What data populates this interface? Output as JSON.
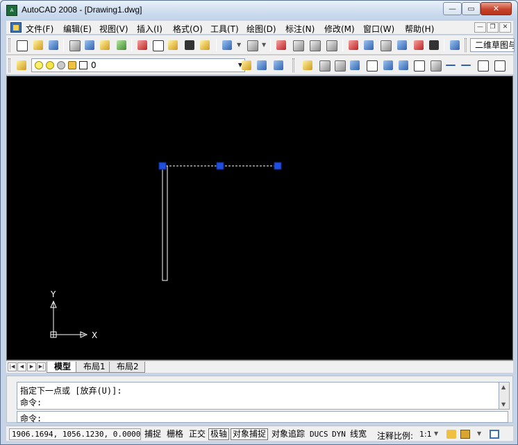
{
  "window": {
    "title": "AutoCAD 2008 - [Drawing1.dwg]",
    "icon_text": "A",
    "controls": {
      "minimize": "—",
      "maximize": "▭",
      "close": "✕"
    }
  },
  "menu": {
    "items": [
      "文件(F)",
      "编辑(E)",
      "视图(V)",
      "插入(I)",
      "格式(O)",
      "工具(T)",
      "绘图(D)",
      "标注(N)",
      "修改(M)",
      "窗口(W)",
      "帮助(H)"
    ],
    "mdi": {
      "minimize": "—",
      "restore": "❐",
      "close": "✕"
    }
  },
  "toolbar1": {
    "workspace_value": "二维草图与注释"
  },
  "toolbar2": {
    "layer_value": "0"
  },
  "tabs": {
    "items": [
      "模型",
      "布局1",
      "布局2"
    ],
    "active_index": 0
  },
  "command": {
    "history": [
      "指定下一点或 [放弃(U)]:",
      "命令:"
    ],
    "prompt": "命令:"
  },
  "status": {
    "coords": "1906.1694, 1056.1230, 0.0000",
    "toggles": [
      {
        "label": "捕捉",
        "on": false
      },
      {
        "label": "栅格",
        "on": false
      },
      {
        "label": "正交",
        "on": false
      },
      {
        "label": "极轴",
        "on": true
      },
      {
        "label": "对象捕捉",
        "on": true
      },
      {
        "label": "对象追踪",
        "on": false
      },
      {
        "label": "DUCS",
        "on": false
      },
      {
        "label": "DYN",
        "on": false
      },
      {
        "label": "线宽",
        "on": false
      }
    ],
    "annotation_label": "注释比例:",
    "annotation_scale": "1:1"
  },
  "ucs": {
    "x_label": "X",
    "y_label": "Y"
  },
  "colors": {
    "canvas": "#000000",
    "grip": "#1f4fe0",
    "line": "#ffffff",
    "title_gradient_top": "#e9f1fb",
    "close_button": "#c7432a"
  }
}
